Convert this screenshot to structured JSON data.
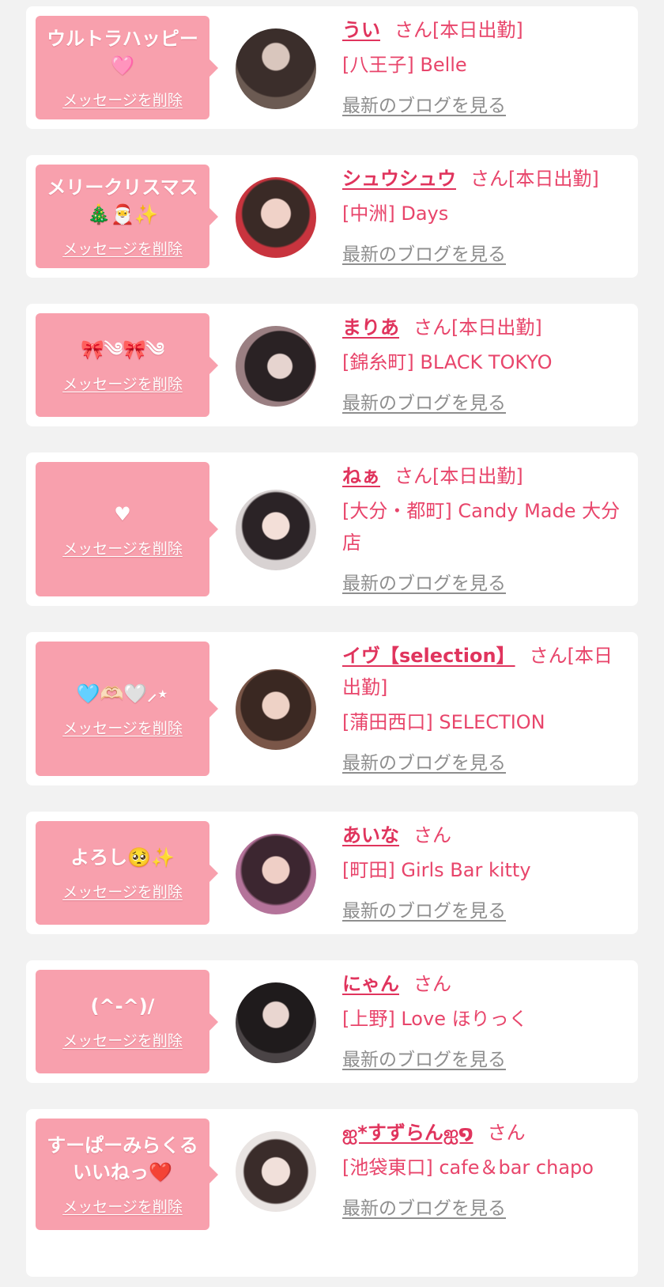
{
  "delete_label": "メッセージを削除",
  "blog_label": "最新のブログを見る",
  "san_label": "さん",
  "items": [
    {
      "message": "ウルトラハッピー🩷",
      "name": "うい",
      "status": "[本日出勤]",
      "shop": "[八王子] Belle"
    },
    {
      "message": "メリークリスマス🎄🎅✨",
      "name": "シュウシュウ",
      "status": "[本日出勤]",
      "shop": "[中洲] Days"
    },
    {
      "message": "🎀༄🎀༄",
      "name": "まりあ",
      "status": "[本日出勤]",
      "shop": "[錦糸町] BLACK TOKYO"
    },
    {
      "message": "♥",
      "name": "ねぁ",
      "status": "[本日出勤]",
      "shop": "[大分・都町] Candy Made 大分店"
    },
    {
      "message": "🩵🫶🏻🤍⸝⋆",
      "name": "イヴ【selection】",
      "status": "[本日出勤]",
      "shop": "[蒲田西口] SELECTION"
    },
    {
      "message": "よろし🥺✨",
      "name": "あいな",
      "status": "",
      "shop": "[町田] Girls Bar kitty"
    },
    {
      "message": "(^-^)/",
      "name": "にゃん",
      "status": "",
      "shop": "[上野] Love ほりっく"
    },
    {
      "message": "すーぱーみらくるいいねっ❤️",
      "name": "ஐ*すずらんஐ໑",
      "status": "",
      "shop": "[池袋東口] cafe＆bar chapo"
    }
  ],
  "colors": {
    "bubble": "#f8a0ad",
    "name": "#e0345d",
    "text": "#e8456b",
    "blog": "#8e8e8e"
  }
}
